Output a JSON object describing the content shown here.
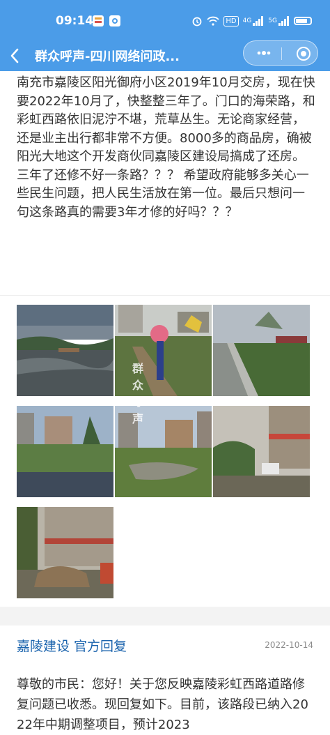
{
  "status_bar": {
    "time": "09:14",
    "hd_badge": "HD",
    "network_1": "4G",
    "network_2": "5G"
  },
  "navbar": {
    "back_icon": "chevron-left-icon",
    "title": "群众呼声-四川网络问政...",
    "more_icon": "more-dots-icon",
    "close_icon": "target-close-icon",
    "color": "#4b9ce8"
  },
  "post": {
    "body": "南充市嘉陵区阳光御府小区2019年10月交房，现在快要2022年10月了，快整整三年了。门口的海荣路，和彩虹西路依旧泥泞不堪，荒草丛生。无论商家经营，还是业主出行都非常不方便。8000多的商品房，确被阳光大地这个开发商伙同嘉陵区建设局搞成了还房。三年了还修不好一条路？？？ 希望政府能够多关心一些民生问题，把人民生活放在第一位。最后只想问一句这条路真的需要3年才修的好吗？？？",
    "watermark": "群众呼声",
    "photos": [
      {
        "name": "photo-muddy-road-dusk"
      },
      {
        "name": "photo-umbrella-construction"
      },
      {
        "name": "photo-sidewalk-weeds"
      },
      {
        "name": "photo-flooded-lot"
      },
      {
        "name": "photo-puddle-field"
      },
      {
        "name": "photo-street-shops-rain"
      },
      {
        "name": "photo-debris-storefront"
      }
    ]
  },
  "reply": {
    "header": "嘉陵建设 官方回复",
    "date": "2022-10-14",
    "body": "尊敬的市民：您好！关于您反映嘉陵彩虹西路道路修复问题已收悉。现回复如下。目前，该路段已纳入2022年中期调整项目，预计2023"
  }
}
